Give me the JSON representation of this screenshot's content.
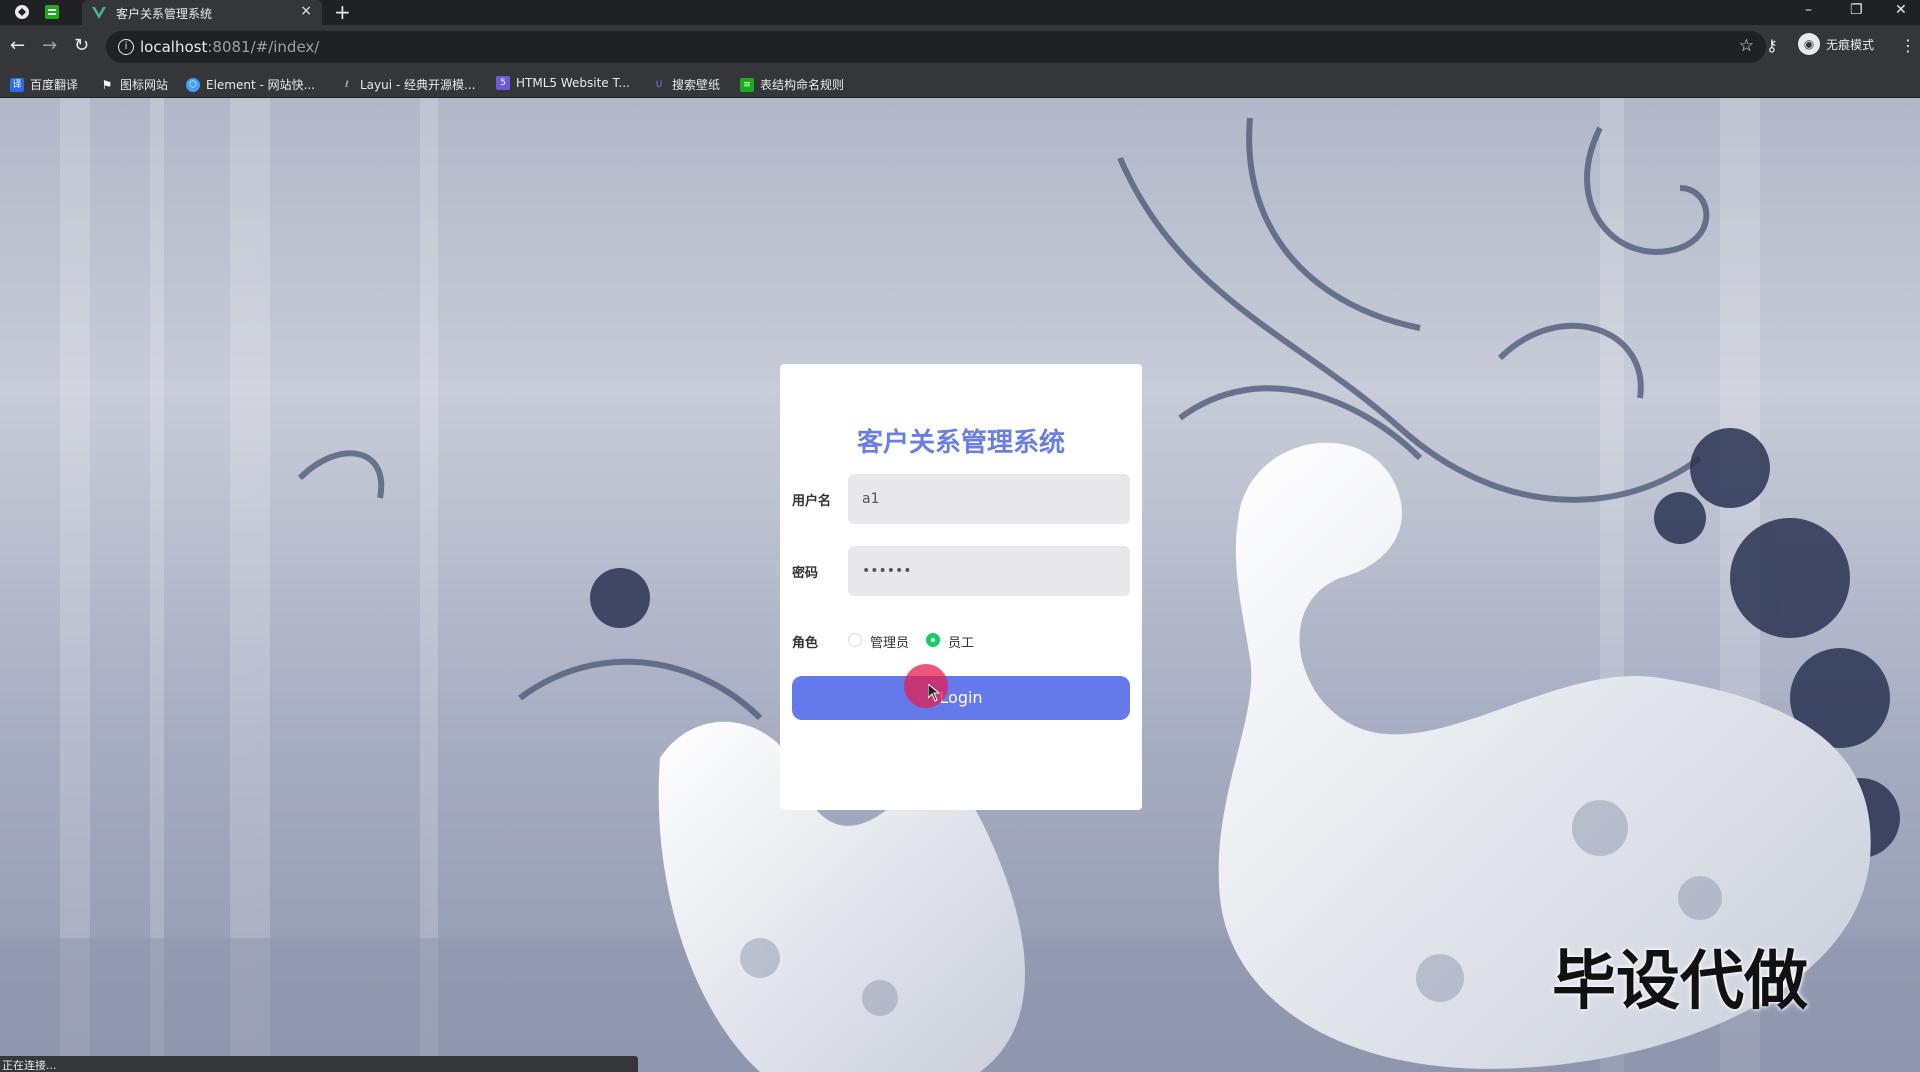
{
  "browser": {
    "tab_title": "客户关系管理系统",
    "tab_close": "×",
    "new_tab": "+",
    "window_minimize": "–",
    "window_restore": "❐",
    "window_close": "✕",
    "url_host": "localhost",
    "url_rest": ":8081/#/index/",
    "incognito_label": "无痕模式",
    "status_text": "正在连接..."
  },
  "bookmarks": [
    {
      "label": "百度翻译",
      "color": "#2b6de6",
      "icon": "translate-icon"
    },
    {
      "label": "图标网站",
      "color": "#ffffff",
      "icon": "flag-icon"
    },
    {
      "label": "Element - 网站快...",
      "color": "#409eff",
      "icon": "element-icon"
    },
    {
      "label": "Layui - 经典开源模...",
      "color": "#cccccc",
      "icon": "layui-icon"
    },
    {
      "label": "HTML5 Website T...",
      "color": "#6b5bd6",
      "icon": "html5-template-icon"
    },
    {
      "label": "搜索壁纸",
      "color": "#4a8af4",
      "icon": "wallpaper-icon"
    },
    {
      "label": "表结构命名规则",
      "color": "#1aad19",
      "icon": "doc-icon"
    }
  ],
  "login": {
    "title": "客户关系管理系统",
    "username_label": "用户名",
    "username_value": "a1",
    "password_label": "密码",
    "password_value": "••••••",
    "role_label": "角色",
    "role_options": [
      "管理员",
      "员工"
    ],
    "role_selected": "员工",
    "button_label": "Login"
  },
  "watermark": "毕设代做",
  "colors": {
    "accent": "#6479ea",
    "title": "#6a7fe0",
    "radio_checked": "#13ce66"
  }
}
